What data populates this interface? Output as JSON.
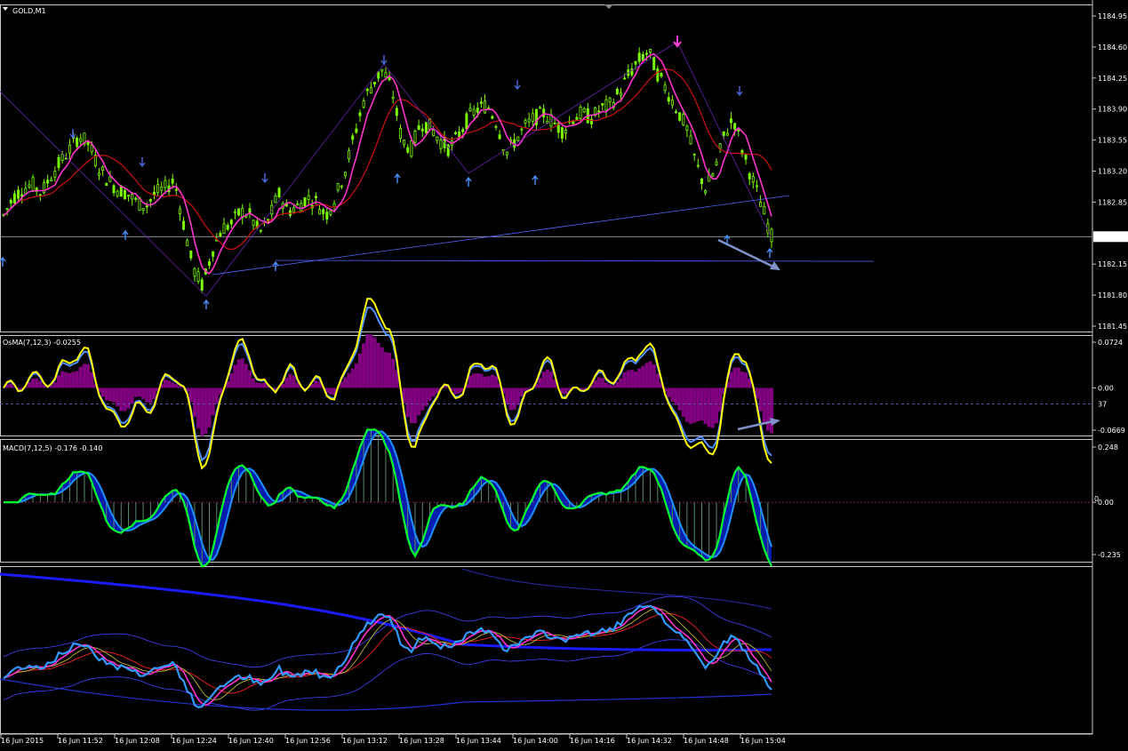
{
  "chart_data": [
    {
      "type": "candlestick",
      "title": "GOLD,M1",
      "y_ticks": [
        "1184.95",
        "1184.60",
        "1184.25",
        "1183.90",
        "1183.55",
        "1183.20",
        "1182.85",
        "1182.46",
        "1182.15",
        "1181.80",
        "1181.45"
      ],
      "current_price": "1182.46",
      "ylim": [
        1181.45,
        1184.95
      ],
      "series_close": [
        1182.7,
        1182.9,
        1183.0,
        1183.05,
        1182.95,
        1183.15,
        1183.3,
        1183.45,
        1183.6,
        1183.5,
        1183.25,
        1183.1,
        1183.0,
        1182.95,
        1182.85,
        1182.8,
        1182.95,
        1183.0,
        1183.1,
        1182.6,
        1182.1,
        1181.9,
        1182.3,
        1182.55,
        1182.6,
        1182.75,
        1182.7,
        1182.5,
        1182.65,
        1182.95,
        1182.75,
        1182.8,
        1182.9,
        1182.85,
        1182.7,
        1182.9,
        1183.2,
        1183.6,
        1184.0,
        1184.2,
        1184.35,
        1184.1,
        1183.55,
        1183.45,
        1183.75,
        1183.7,
        1183.55,
        1183.45,
        1183.6,
        1183.8,
        1183.9,
        1183.95,
        1183.75,
        1183.4,
        1183.55,
        1183.7,
        1183.8,
        1183.85,
        1183.75,
        1183.65,
        1183.8,
        1183.85,
        1183.8,
        1183.9,
        1183.95,
        1184.1,
        1184.3,
        1184.45,
        1184.55,
        1184.3,
        1184.1,
        1183.9,
        1183.7,
        1183.3,
        1183.0,
        1183.2,
        1183.6,
        1183.8,
        1183.4,
        1183.1,
        1182.8,
        1182.46
      ]
    },
    {
      "type": "line",
      "title": "OsMA(7,12,3) -0.0255",
      "y_ticks": [
        "0.0724",
        "0.00",
        "-0.0669"
      ],
      "extra_label": "37",
      "ylim": [
        -0.0669,
        0.0724
      ]
    },
    {
      "type": "bar",
      "title": "MACD(7,12,5) -0.176 -0.140",
      "y_ticks": [
        "0.248",
        "0.00",
        "-0.235"
      ],
      "zero_label": "0",
      "ylim": [
        -0.235,
        0.248
      ]
    },
    {
      "type": "line",
      "title": "",
      "y_ticks": []
    }
  ],
  "x_ticks": [
    "16 Jun 2015",
    "16 Jun 11:52",
    "16 Jun 12:08",
    "16 Jun 12:24",
    "16 Jun 12:40",
    "16 Jun 12:56",
    "16 Jun 13:12",
    "16 Jun 13:28",
    "16 Jun 13:44",
    "16 Jun 14:00",
    "16 Jun 14:16",
    "16 Jun 14:32",
    "16 Jun 14:48",
    "16 Jun 15:04"
  ],
  "colors": {
    "background": "#000000",
    "candle": "#7CFC00",
    "ma_fast": "#FF33CC",
    "ma_slow": "#CC1111",
    "trendline": "#5566FF",
    "zigzag": "#6622AA",
    "arrow_up": "#4A90FF",
    "arrow_down": "#4A6ADB",
    "osma_hist": "#800080",
    "osma_line": "#FFFF00",
    "osma_signal": "#4F8FFF",
    "macd_line": "#00FF33",
    "macd_signal": "#1E90FF",
    "macd_fill": "#0022CC",
    "macd_hist": "#5a8a6a",
    "bands": "#4444FF",
    "price_line": "#3399FF"
  }
}
